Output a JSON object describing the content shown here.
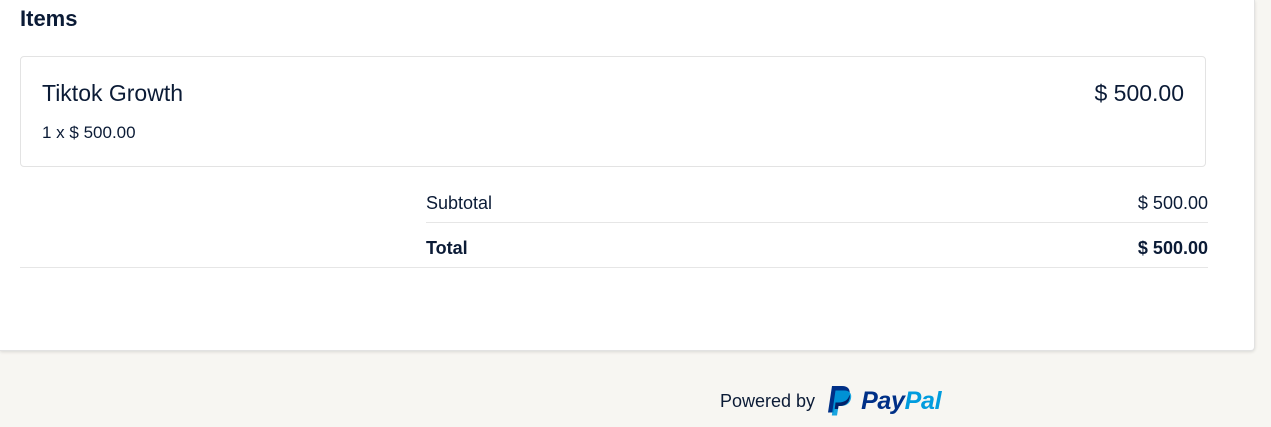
{
  "items_section": {
    "heading": "Items"
  },
  "item": {
    "name": "Tiktok Growth",
    "price": "$ 500.00",
    "quantity_line": "1 x $ 500.00"
  },
  "summary": {
    "subtotal_label": "Subtotal",
    "subtotal_value": "$ 500.00",
    "total_label": "Total",
    "total_value": "$ 500.00"
  },
  "footer": {
    "powered_by": "Powered by",
    "brand_pay": "Pay",
    "brand_pal": "Pal"
  },
  "colors": {
    "text": "#0b1b36",
    "paypal_dark": "#003087",
    "paypal_light": "#009cde",
    "page_background": "#f7f6f2"
  }
}
